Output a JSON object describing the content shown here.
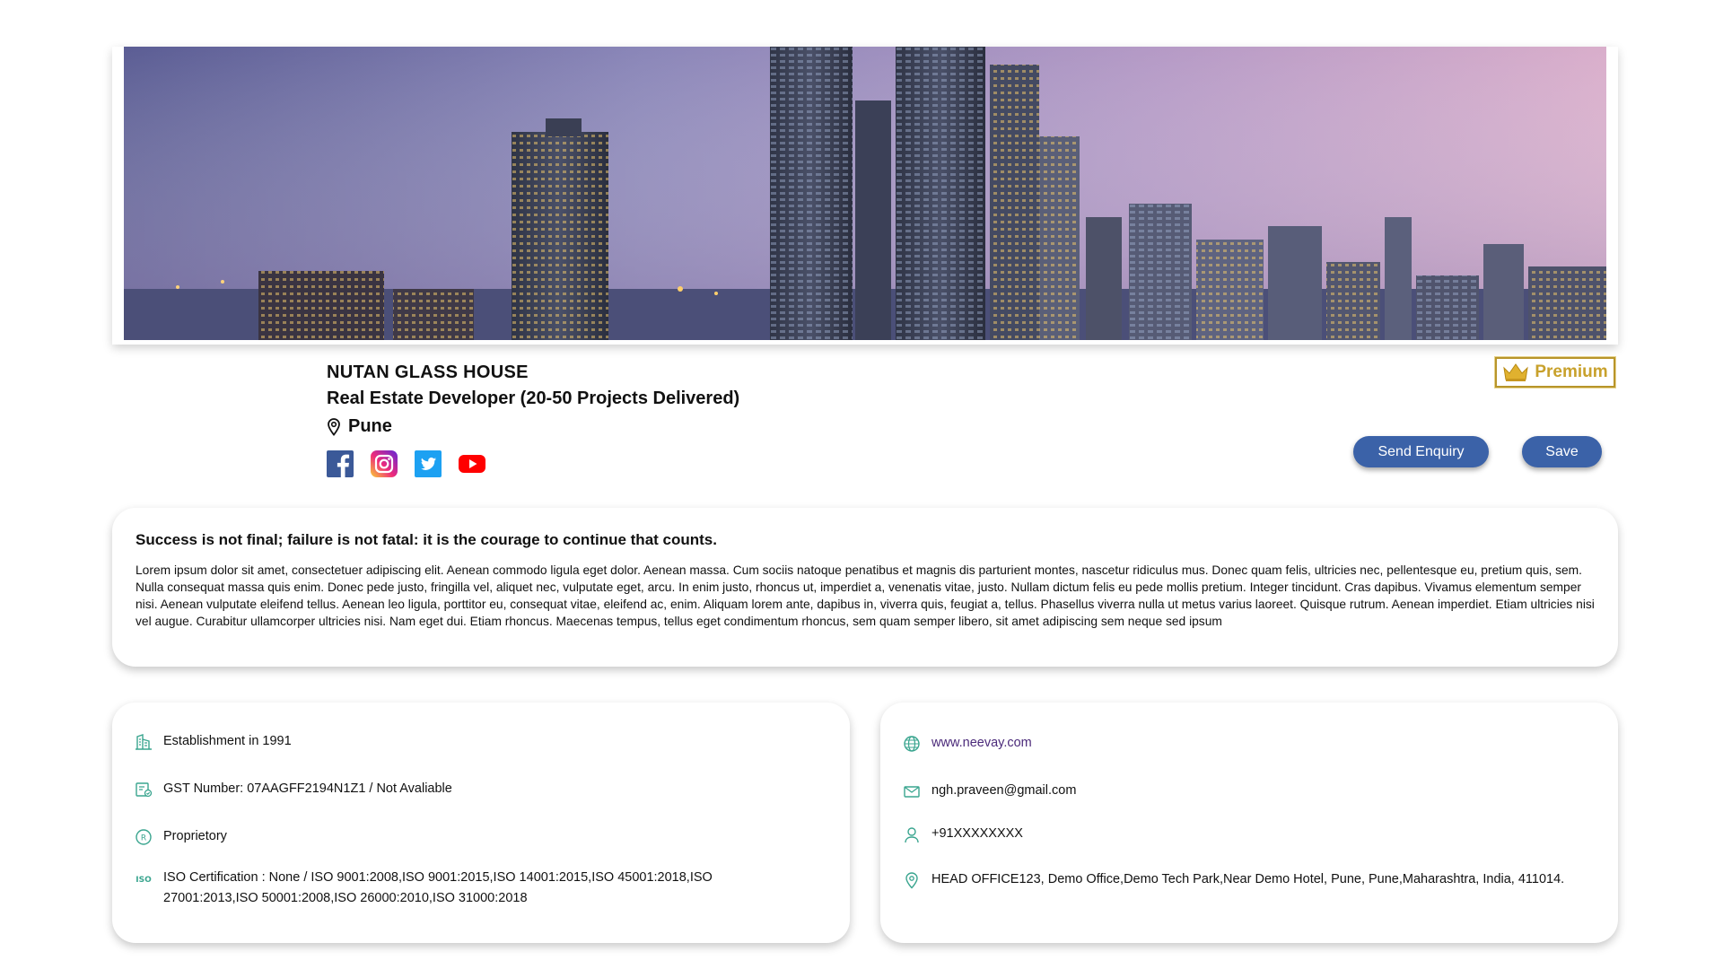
{
  "company": {
    "name": "NUTAN GLASS HOUSE",
    "type": "Real Estate Developer (20-50 Projects Delivered)",
    "city": "Pune"
  },
  "badge": {
    "label": "Premium"
  },
  "actions": {
    "enquiry_label": "Send Enquiry",
    "save_label": "Save"
  },
  "socials": [
    {
      "name": "facebook-icon"
    },
    {
      "name": "instagram-icon"
    },
    {
      "name": "twitter-icon"
    },
    {
      "name": "youtube-icon"
    }
  ],
  "about": {
    "quote": "Success is not final; failure is not fatal: it is the courage to continue that counts.",
    "text": "Lorem ipsum dolor sit amet, consectetuer adipiscing elit. Aenean commodo ligula eget dolor. Aenean massa. Cum sociis natoque penatibus et magnis dis parturient montes, nascetur ridiculus mus. Donec quam felis, ultricies nec, pellentesque eu, pretium quis, sem. Nulla consequat massa quis enim. Donec pede justo, fringilla vel, aliquet nec, vulputate eget, arcu. In enim justo, rhoncus ut, imperdiet a, venenatis vitae, justo. Nullam dictum felis eu pede mollis pretium. Integer tincidunt. Cras dapibus. Vivamus elementum semper nisi. Aenean vulputate eleifend tellus. Aenean leo ligula, porttitor eu, consequat vitae, eleifend ac, enim. Aliquam lorem ante, dapibus in, viverra quis, feugiat a, tellus. Phasellus viverra nulla ut metus varius laoreet. Quisque rutrum. Aenean imperdiet. Etiam ultricies nisi vel augue. Curabitur ullamcorper ultricies nisi. Nam eget dui. Etiam rhoncus. Maecenas tempus, tellus eget condimentum rhoncus, sem quam semper libero, sit amet adipiscing sem neque sed ipsum"
  },
  "details": {
    "establishment": "Establishment in 1991",
    "gst": "GST Number: 07AAGFF2194N1Z1 / Not Avaliable",
    "ownership": "Proprietory",
    "iso_line1": "ISO Certification : None / ISO 9001:2008,ISO 9001:2015,ISO 14001:2015,ISO 45001:2018,ISO",
    "iso_line2": "27001:2013,ISO 50001:2008,ISO 26000:2010,ISO 31000:2018"
  },
  "contact": {
    "website": "www.neevay.com",
    "email": "ngh.praveen@gmail.com",
    "phone": "+91XXXXXXXX",
    "address": "HEAD OFFICE123, Demo Office,Demo Tech Park,Near Demo Hotel, Pune, Pune,Maharashtra, India, 411014."
  },
  "colors": {
    "primary_button": "#3b62a8",
    "premium_gold": "#c8a12c",
    "icon_teal": "#3aa58f"
  }
}
